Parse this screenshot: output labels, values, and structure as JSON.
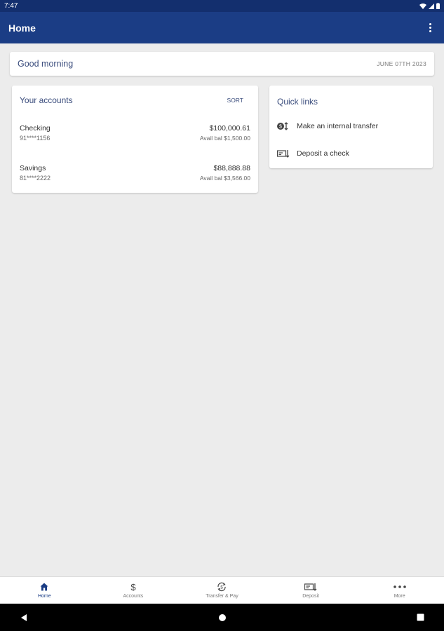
{
  "status_bar": {
    "time": "7:47"
  },
  "app_bar": {
    "title": "Home"
  },
  "greeting": {
    "text": "Good morning",
    "date": "JUNE 07TH 2023"
  },
  "accounts": {
    "title": "Your accounts",
    "sort_label": "SORT",
    "items": [
      {
        "name": "Checking",
        "number": "91****1156",
        "balance": "$100,000.61",
        "available": "Avail bal $1,500.00"
      },
      {
        "name": "Savings",
        "number": "81****2222",
        "balance": "$88,888.88",
        "available": "Avail bal $3,566.00"
      }
    ]
  },
  "quick_links": {
    "title": "Quick links",
    "items": [
      {
        "label": "Make an internal transfer",
        "icon": "transfer-icon"
      },
      {
        "label": "Deposit a check",
        "icon": "check-deposit-icon"
      }
    ]
  },
  "bottom_nav": {
    "items": [
      {
        "label": "Home",
        "icon": "home-icon",
        "active": true
      },
      {
        "label": "Accounts",
        "icon": "dollar-icon",
        "active": false
      },
      {
        "label": "Transfer & Pay",
        "icon": "transfer-pay-icon",
        "active": false
      },
      {
        "label": "Deposit",
        "icon": "deposit-icon",
        "active": false
      },
      {
        "label": "More",
        "icon": "more-icon",
        "active": false
      }
    ]
  },
  "colors": {
    "primary": "#1b3d85",
    "status_bar": "#132f6e",
    "accent_text": "#3b4d7d",
    "background": "#ececec"
  }
}
